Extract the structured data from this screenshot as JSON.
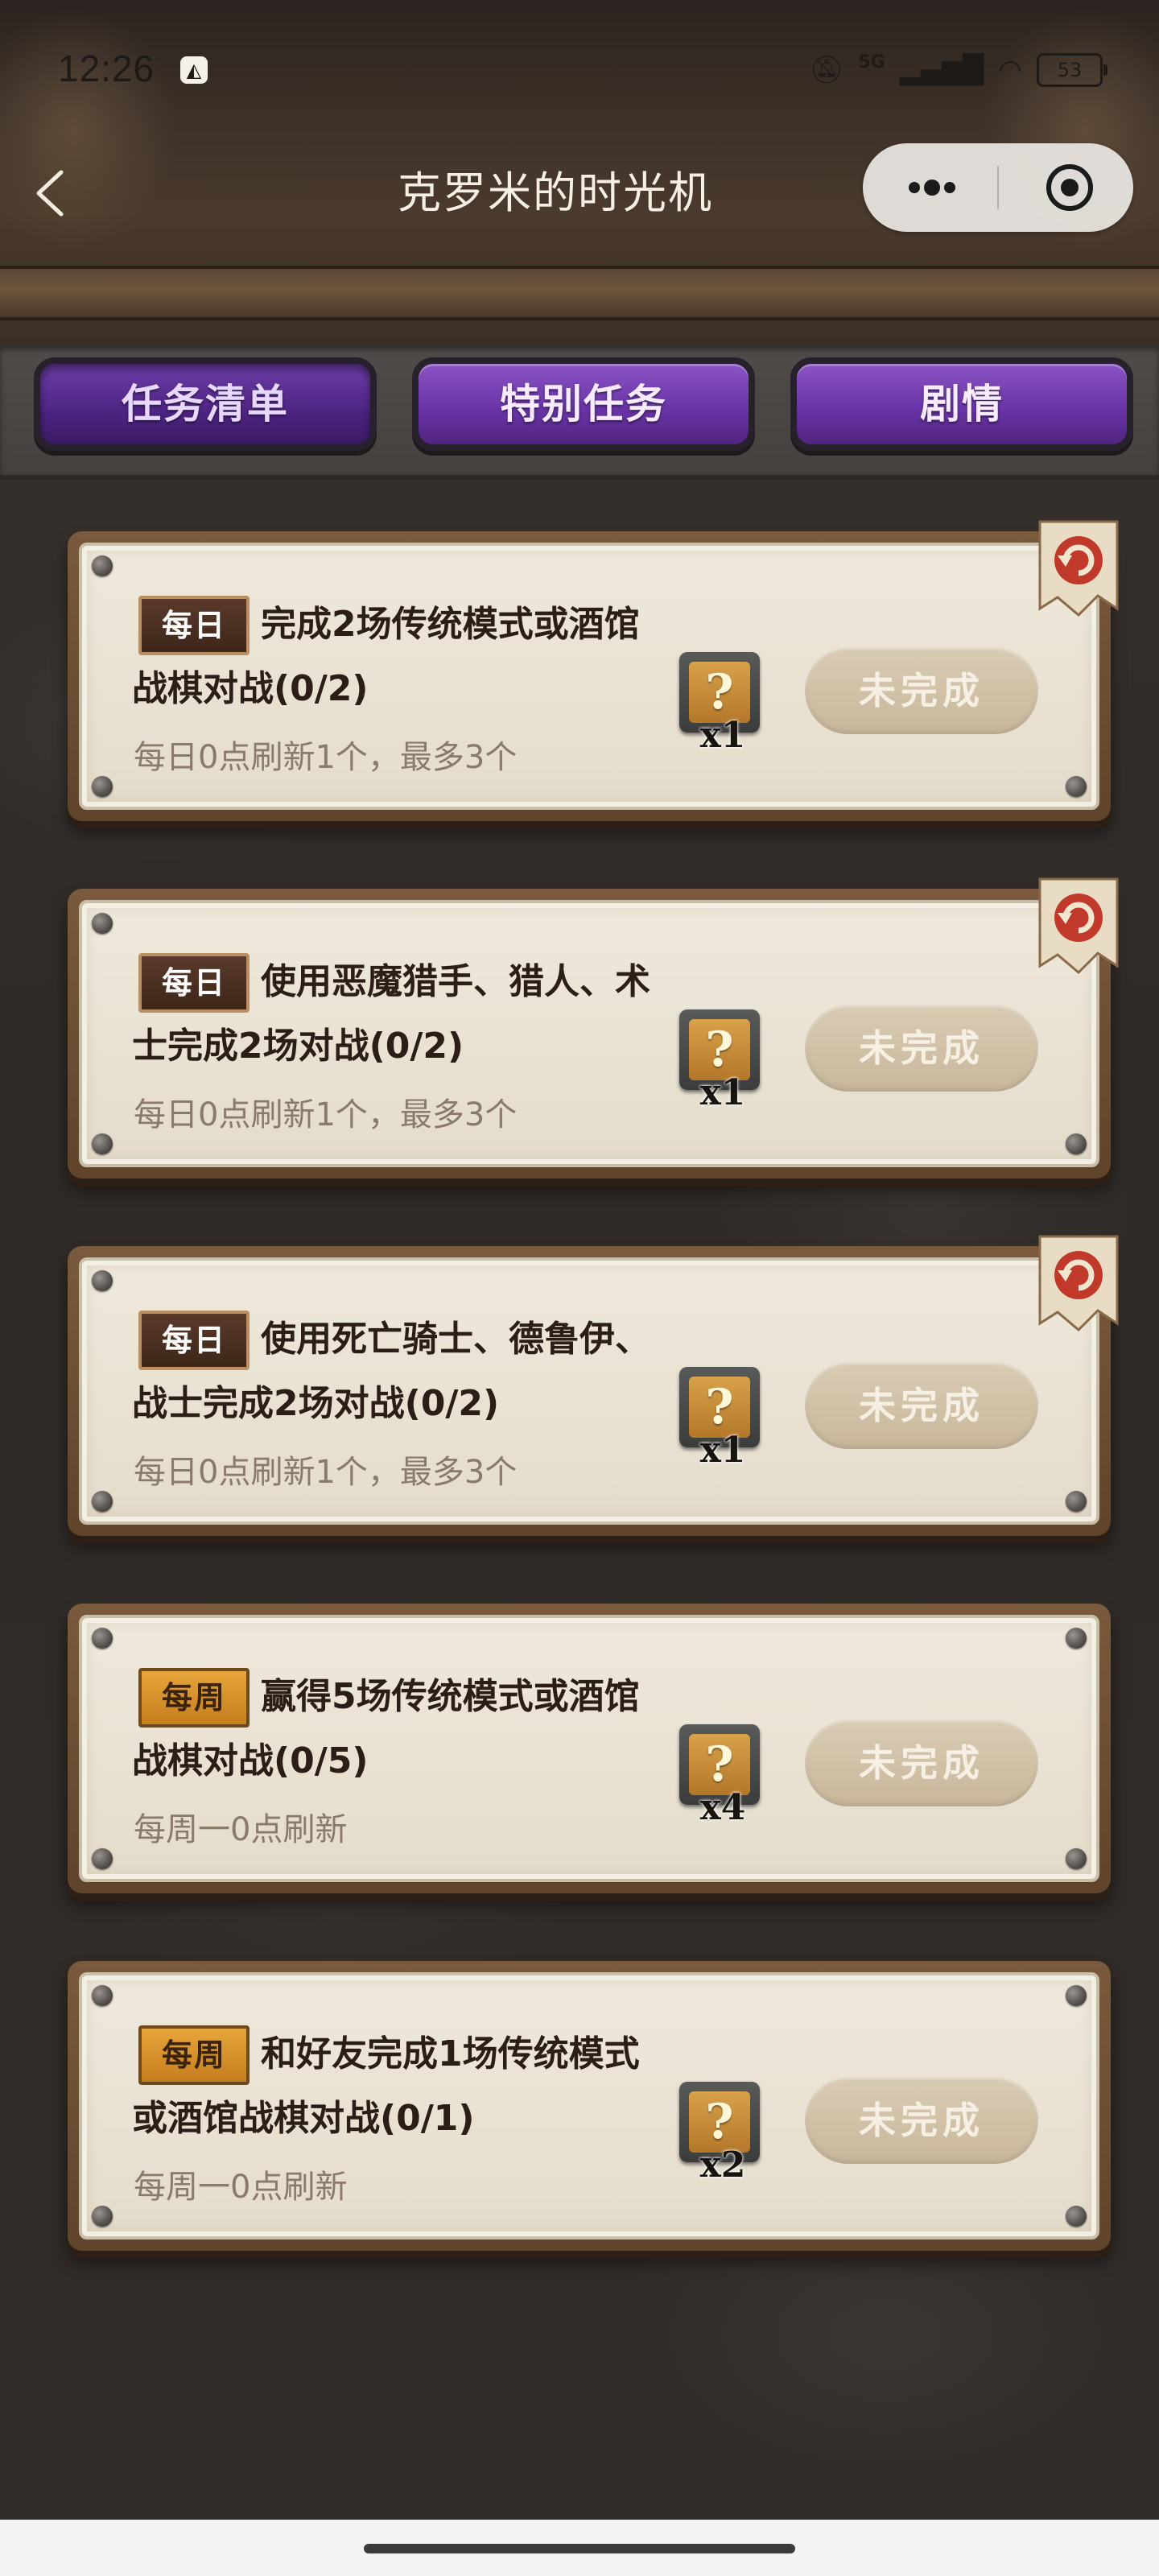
{
  "status_bar": {
    "time": "12:26",
    "network": "5G",
    "battery": "53"
  },
  "header": {
    "title": "克罗米的时光机"
  },
  "tabs": [
    {
      "label": "任务清单",
      "active": true
    },
    {
      "label": "特别任务",
      "active": false
    },
    {
      "label": "剧情",
      "active": false
    }
  ],
  "quests": [
    {
      "badge": "每日",
      "badge_type": "daily",
      "text": "完成2场传统模式或酒馆战棋对战(0/2)",
      "refresh": "每日0点刷新1个，最多3个",
      "reward_count": "x1",
      "status": "未完成",
      "has_refresh_flag": true
    },
    {
      "badge": "每日",
      "badge_type": "daily",
      "text": "使用恶魔猎手、猎人、术士完成2场对战(0/2)",
      "refresh": "每日0点刷新1个，最多3个",
      "reward_count": "x1",
      "status": "未完成",
      "has_refresh_flag": true
    },
    {
      "badge": "每日",
      "badge_type": "daily",
      "text": "使用死亡骑士、德鲁伊、战士完成2场对战(0/2)",
      "refresh": "每日0点刷新1个，最多3个",
      "reward_count": "x1",
      "status": "未完成",
      "has_refresh_flag": true
    },
    {
      "badge": "每周",
      "badge_type": "weekly",
      "text": "赢得5场传统模式或酒馆战棋对战(0/5)",
      "refresh": "每周一0点刷新",
      "reward_count": "x4",
      "status": "未完成",
      "has_refresh_flag": false
    },
    {
      "badge": "每周",
      "badge_type": "weekly",
      "text": "和好友完成1场传统模式或酒馆战棋对战(0/1)",
      "refresh": "每周一0点刷新",
      "reward_count": "x2",
      "status": "未完成",
      "has_refresh_flag": false
    }
  ]
}
